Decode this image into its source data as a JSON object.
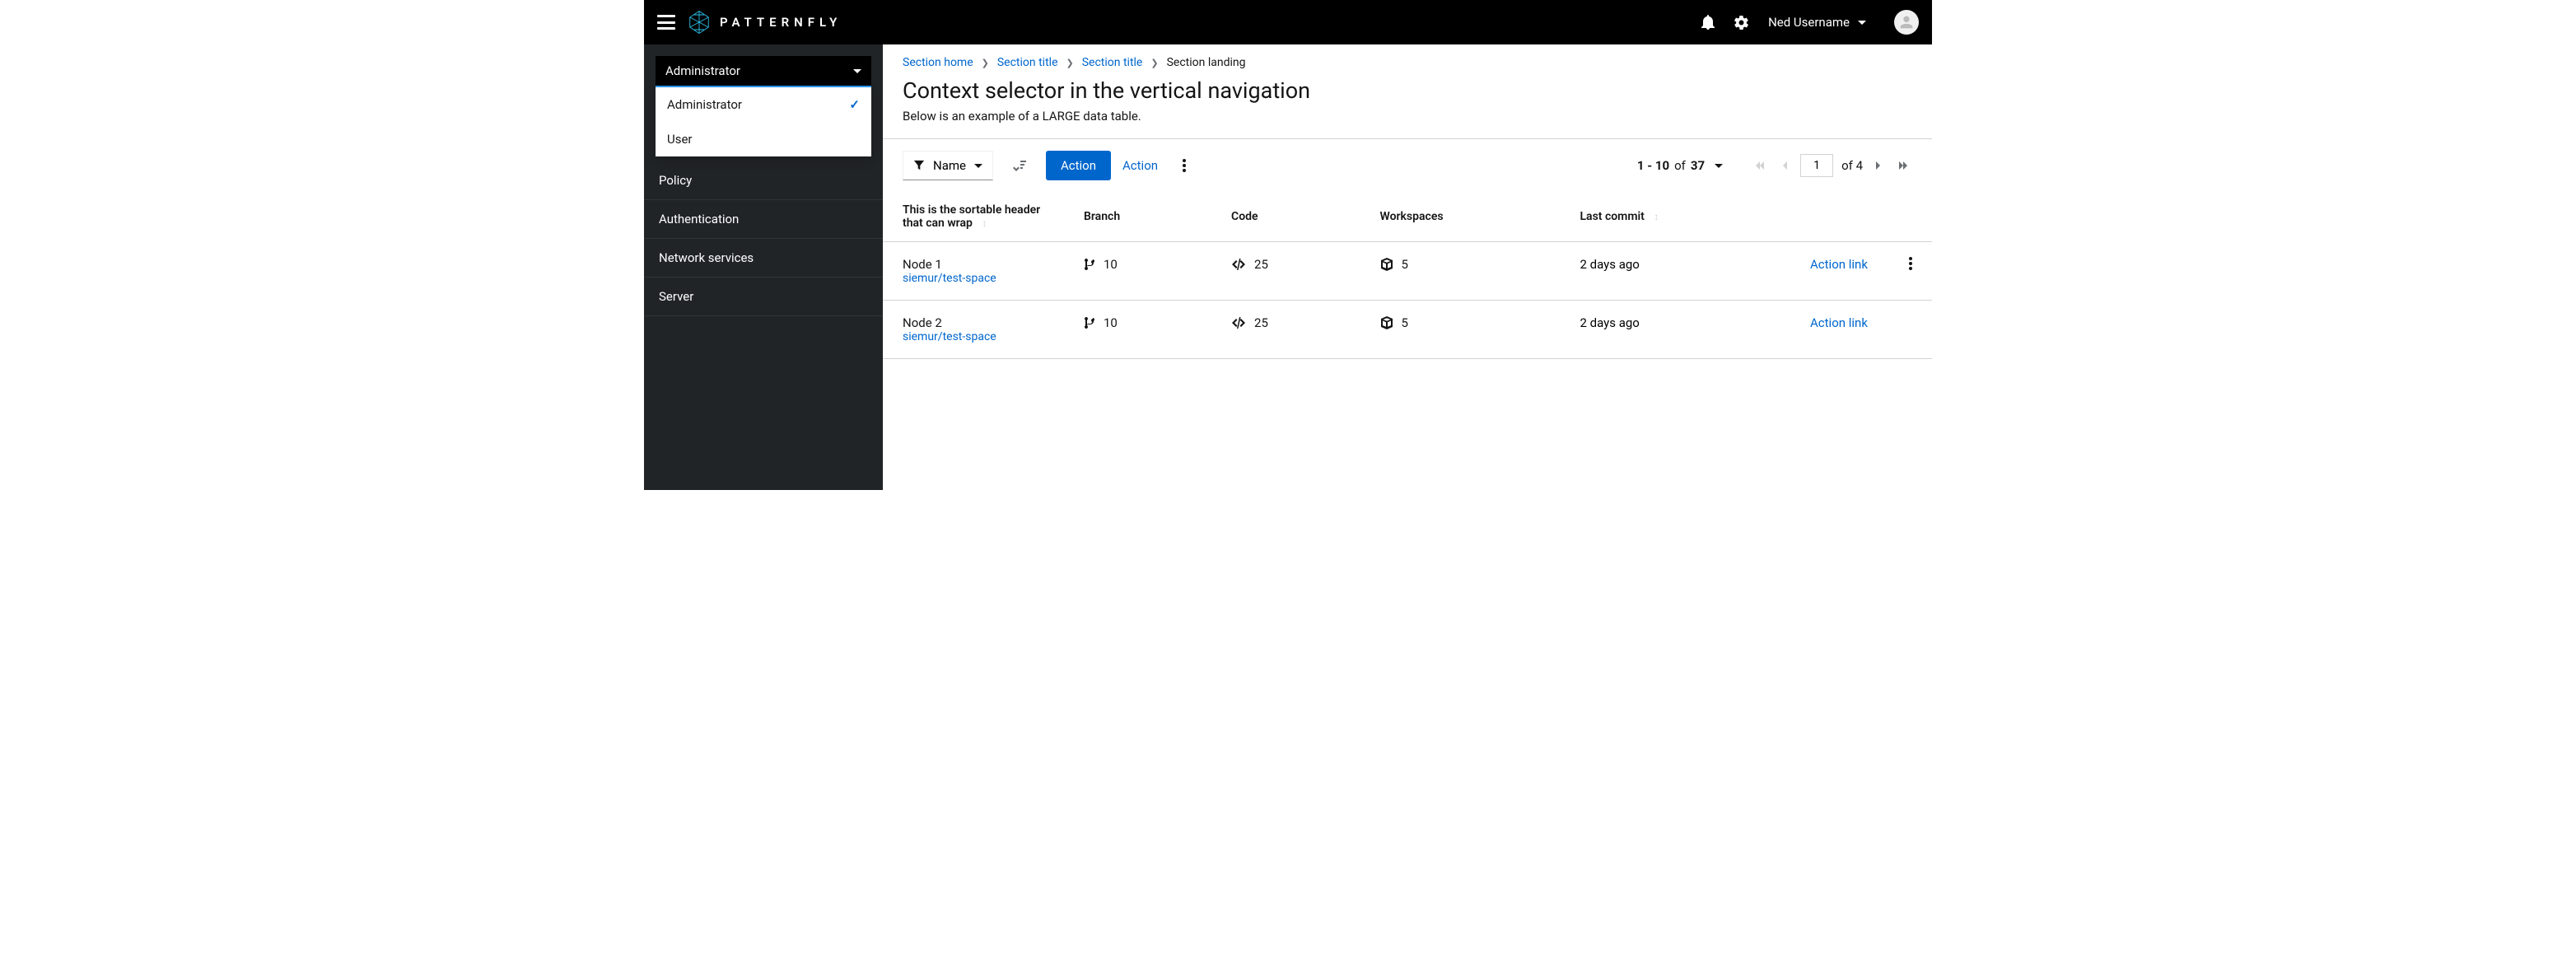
{
  "header": {
    "brand": "PATTERNFLY",
    "username": "Ned Username"
  },
  "sidebar": {
    "context_selector": {
      "selected": "Administrator",
      "options": [
        {
          "label": "Administrator",
          "selected": true
        },
        {
          "label": "User",
          "selected": false
        }
      ]
    },
    "nav": [
      "Policy",
      "Authentication",
      "Network services",
      "Server"
    ]
  },
  "breadcrumb": {
    "items": [
      {
        "label": "Section home",
        "link": true
      },
      {
        "label": "Section title",
        "link": true
      },
      {
        "label": "Section title",
        "link": true
      },
      {
        "label": "Section landing",
        "link": false
      }
    ]
  },
  "page": {
    "title": "Context selector in the vertical navigation",
    "subtitle": "Below is an example of a LARGE data table."
  },
  "toolbar": {
    "filter_label": "Name",
    "primary_action": "Action",
    "secondary_action": "Action",
    "pagination": {
      "range_text": "1 - 10",
      "of_text": "of",
      "total": "37",
      "page_value": "1",
      "page_of_text": "of 4"
    }
  },
  "table": {
    "columns": {
      "c0": "This is the sortable header that can wrap",
      "c1": "Branch",
      "c2": "Code",
      "c3": "Workspaces",
      "c4": "Last commit",
      "c5_action": "Action link"
    },
    "rows": [
      {
        "name": "Node 1",
        "repo": "siemur/test-space",
        "branch": "10",
        "code": "25",
        "workspaces": "5",
        "last_commit": "2 days ago"
      },
      {
        "name": "Node 2",
        "repo": "siemur/test-space",
        "branch": "10",
        "code": "25",
        "workspaces": "5",
        "last_commit": "2 days ago"
      }
    ]
  }
}
